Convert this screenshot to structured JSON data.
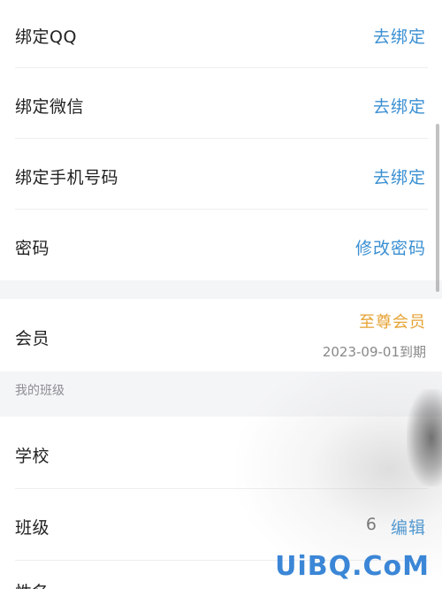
{
  "account_bindings": [
    {
      "label": "绑定QQ",
      "action": "去绑定"
    },
    {
      "label": "绑定微信",
      "action": "去绑定"
    },
    {
      "label": "绑定手机号码",
      "action": "去绑定"
    },
    {
      "label": "密码",
      "action": "修改密码"
    }
  ],
  "membership": {
    "label": "会员",
    "level": "至尊会员",
    "expiry": "2023-09-01到期"
  },
  "my_class": {
    "section_title": "我的班级",
    "school_label": "学校",
    "class_label": "班级",
    "class_value": "6",
    "class_action": "编辑",
    "partial_next_label": "性名"
  },
  "watermark": "UiBQ.CoM",
  "colors": {
    "action_blue": "#3a8fd2",
    "premium_gold": "#e5a334",
    "section_bg": "#f4f5f7"
  }
}
